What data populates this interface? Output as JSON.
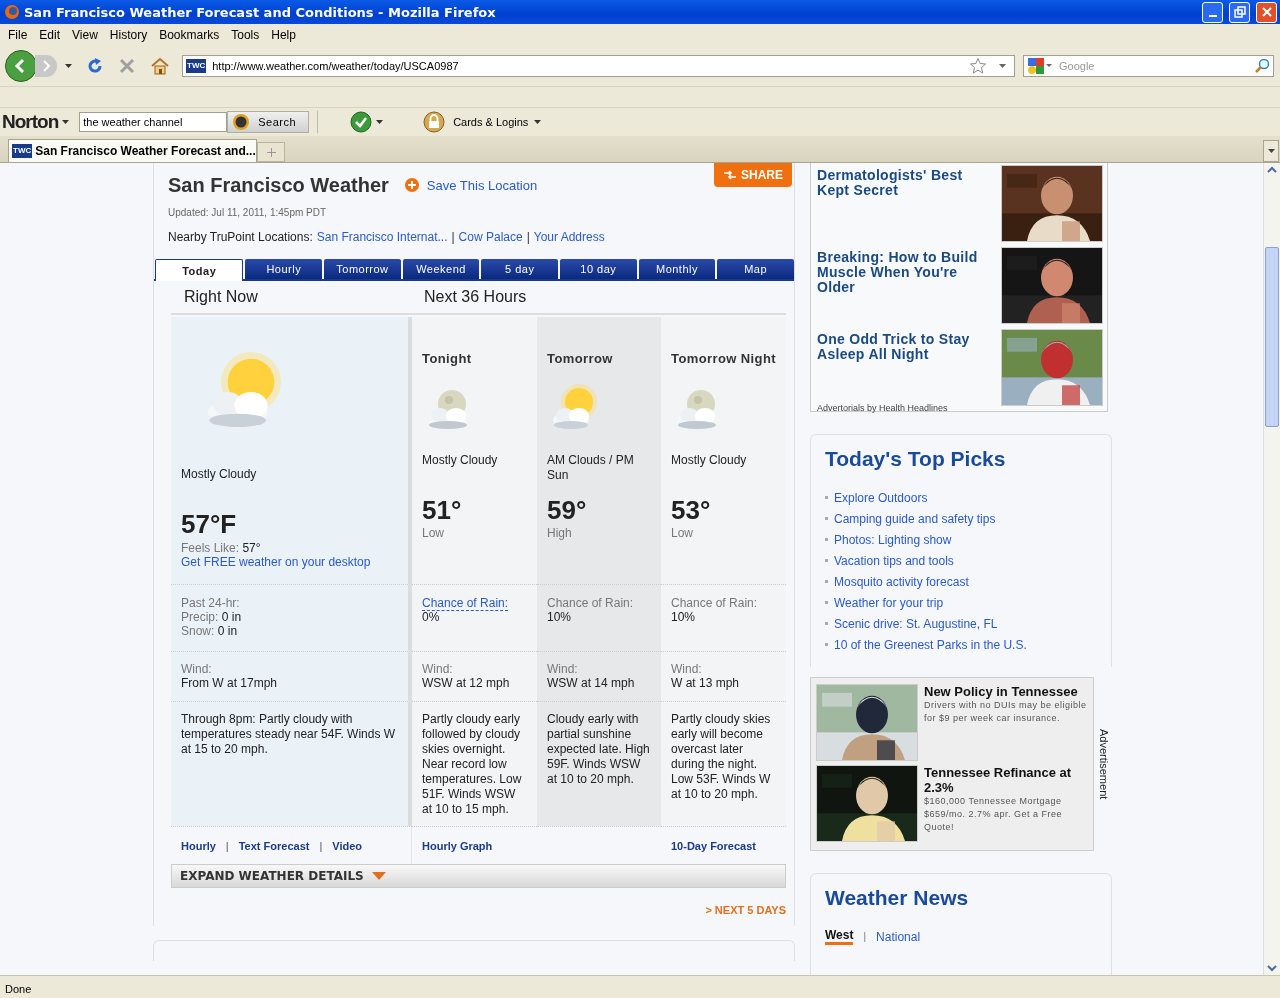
{
  "window": {
    "title": "San Francisco Weather Forecast and Conditions - Mozilla Firefox"
  },
  "menu": [
    "File",
    "Edit",
    "View",
    "History",
    "Bookmarks",
    "Tools",
    "Help"
  ],
  "address": {
    "favicon": "TWC",
    "url": "http://www.weather.com/weather/today/USCA0987"
  },
  "search": {
    "placeholder": "Google"
  },
  "norton": {
    "brand": "Norton",
    "search_value": "the weather channel",
    "search_button": "Search",
    "cards": "Cards & Logins"
  },
  "tabs": [
    {
      "favicon": "TWC",
      "title": "San Francisco Weather Forecast and...",
      "selected": true
    }
  ],
  "page": {
    "title": "San Francisco Weather",
    "save": "Save This Location",
    "share": "SHARE",
    "updated": "Updated: Jul 11, 2011, 1:45pm PDT",
    "nearby_label": "Nearby TruPoint Locations:",
    "nearby": [
      "San Francisco Internat...",
      "Cow Palace",
      "Your Address"
    ],
    "separator": "|"
  },
  "forecast_tabs": [
    {
      "label": "Today",
      "selected": true
    },
    {
      "label": "Hourly",
      "selected": false
    },
    {
      "label": "Tomorrow",
      "selected": false
    },
    {
      "label": "Weekend",
      "selected": false
    },
    {
      "label": "5 day",
      "selected": false
    },
    {
      "label": "10 day",
      "selected": false
    },
    {
      "label": "Monthly",
      "selected": false
    },
    {
      "label": "Map",
      "selected": false
    }
  ],
  "right_now": {
    "heading": "Right Now",
    "condition": "Mostly Cloudy",
    "temp": "57°F",
    "feels_label": "Feels Like:",
    "feels": "57°",
    "desktop_link": "Get FREE weather on your desktop",
    "past_label": "Past 24-hr:",
    "precip_label": "Precip:",
    "precip": "0 in",
    "snow_label": "Snow:",
    "snow": "0 in",
    "wind_label": "Wind:",
    "wind": "From W at 17mph",
    "description": "Through 8pm: Partly cloudy with temperatures steady near 54F. Winds W at 15 to 20 mph.",
    "links": [
      "Hourly",
      "Text Forecast",
      "Video"
    ],
    "separator": "|"
  },
  "next_heading": "Next 36 Hours",
  "periods": [
    {
      "kind": "night",
      "title": "Tonight",
      "condition": "Mostly Cloudy",
      "temp": "51°",
      "temp_label": "Low",
      "rain_label": "Chance of Rain:",
      "rain_link": true,
      "rain": "0%",
      "wind_label": "Wind:",
      "wind": "WSW at 12 mph",
      "description": "Partly cloudy early followed by cloudy skies overnight. Near record low temperatures. Low 51F. Winds WSW at 10 to 15 mph.",
      "link": "Hourly Graph"
    },
    {
      "kind": "day",
      "title": "Tomorrow",
      "condition": "AM Clouds / PM Sun",
      "temp": "59°",
      "temp_label": "High",
      "rain_label": "Chance of Rain:",
      "rain_link": false,
      "rain": "10%",
      "wind_label": "Wind:",
      "wind": "WSW at 14 mph",
      "description": "Cloudy early with partial sunshine expected late. High 59F. Winds WSW at 10 to 20 mph."
    },
    {
      "kind": "night",
      "title": "Tomorrow Night",
      "condition": "Mostly Cloudy",
      "temp": "53°",
      "temp_label": "Low",
      "rain_label": "Chance of Rain:",
      "rain_link": false,
      "rain": "10%",
      "wind_label": "Wind:",
      "wind": "W at 13 mph",
      "description": "Partly cloudy skies early will become overcast later during the night. Low 53F. Winds W at 10 to 20 mph.",
      "link": "10-Day Forecast"
    }
  ],
  "expand": "EXPAND WEATHER DETAILS",
  "next_days": "> NEXT 5 DAYS",
  "advertorials": {
    "items": [
      {
        "title": "Dermatologists' Best Kept Secret",
        "kind": "picture"
      },
      {
        "title": "Breaking: How to Build Muscle When You're Older",
        "kind": "picture"
      },
      {
        "title": "One Odd Trick to Stay Asleep All Night",
        "kind": "picture"
      }
    ],
    "credit": "Advertorials by  Health  Headlines"
  },
  "top_picks": {
    "title": "Today's Top Picks",
    "items": [
      "Explore Outdoors",
      "Camping guide and safety tips",
      "Photos: Lighting show",
      "Vacation tips and tools",
      "Mosquito activity forecast",
      "Weather for your trip",
      "Scenic drive: St. Augustine, FL",
      "10 of the Greenest Parks in the U.S."
    ]
  },
  "ads": {
    "label": "Advertisement",
    "items": [
      {
        "title": "New Policy in Tennessee",
        "body": "Drivers with no DUIs may be eligible for $9 per week car insurance.",
        "kind": "picture"
      },
      {
        "title": "Tennessee Refinance at 2.3%",
        "body": "$160,000 Tennessee Mortgage $659/mo. 2.7% apr. Get a Free Quote!",
        "kind": "picture"
      }
    ]
  },
  "news": {
    "title": "Weather News",
    "separator": "|",
    "tabs": [
      {
        "label": "West",
        "selected": true
      },
      {
        "label": "National",
        "selected": false
      }
    ]
  },
  "status_bar": {
    "text": "Done"
  }
}
